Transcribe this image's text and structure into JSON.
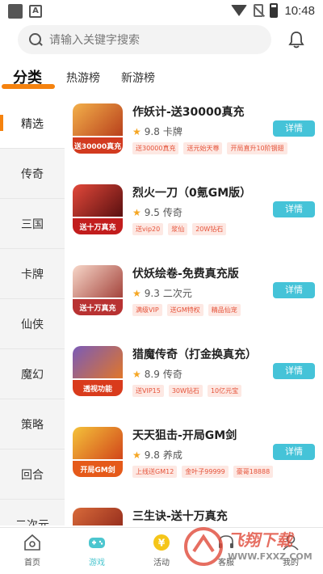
{
  "status_bar": {
    "time": "10:48"
  },
  "search": {
    "placeholder": "请输入关键字搜索"
  },
  "tabs": [
    {
      "label": "分类",
      "active": true
    },
    {
      "label": "热游榜",
      "active": false
    },
    {
      "label": "新游榜",
      "active": false
    }
  ],
  "categories": [
    {
      "label": "精选",
      "active": true
    },
    {
      "label": "传奇"
    },
    {
      "label": "三国"
    },
    {
      "label": "卡牌"
    },
    {
      "label": "仙侠"
    },
    {
      "label": "魔幻"
    },
    {
      "label": "策略"
    },
    {
      "label": "回合"
    },
    {
      "label": "二次元"
    }
  ],
  "games": [
    {
      "title": "作妖计-送30000真充",
      "rating": "9.8",
      "genre": "卡牌",
      "tags": [
        "送30000真充",
        "送元始天尊",
        "开局直升10阶钢翅"
      ],
      "button": "详情",
      "thumb_text": "送30000真充",
      "thumb_color": "#d23a1f"
    },
    {
      "title": "烈火一刀（0氪GM版）",
      "rating": "9.5",
      "genre": "传奇",
      "tags": [
        "送vip20",
        "浆仙",
        "20W钻石"
      ],
      "button": "详情",
      "thumb_text": "送十万真充",
      "thumb_color": "#c21d1d"
    },
    {
      "title": "伏妖绘卷-免费真充版",
      "rating": "9.3",
      "genre": "二次元",
      "tags": [
        "满级VIP",
        "送GM特权",
        "精品仙宠"
      ],
      "button": "详情",
      "thumb_text": "送十万真充",
      "thumb_color": "#b83232"
    },
    {
      "title": "猎魔传奇（打金换真充）",
      "rating": "8.9",
      "genre": "传奇",
      "tags": [
        "送VIP15",
        "30W钻石",
        "10亿元宝"
      ],
      "button": "详情",
      "thumb_text": "透视功能",
      "thumb_color": "#d93b1c"
    },
    {
      "title": "天天狙击-开局GM剑",
      "rating": "9.8",
      "genre": "养成",
      "tags": [
        "上线送GM12",
        "金叶子99999",
        "豪哥18888"
      ],
      "button": "详情",
      "thumb_text": "开局GM剑",
      "thumb_color": "#e55a1a"
    },
    {
      "title": "三生诀-送十万真充",
      "rating": "",
      "genre": "",
      "tags": [],
      "button": "",
      "thumb_text": "",
      "thumb_color": "#c8331f"
    }
  ],
  "bottom_nav": [
    {
      "label": "首页",
      "icon": "home-icon"
    },
    {
      "label": "游戏",
      "icon": "gamepad-icon",
      "active": true
    },
    {
      "label": "活动",
      "icon": "coin-icon"
    },
    {
      "label": "客服",
      "icon": "service-icon"
    },
    {
      "label": "我的",
      "icon": "user-icon"
    }
  ],
  "watermark": {
    "text": "飞翔下载",
    "url": "WWW.FXXZ.COM"
  },
  "colors": {
    "accent": "#f5820e",
    "button": "#45c3d8",
    "tag_text": "#e5533a",
    "tag_bg": "#fde8e3",
    "nav_active": "#4cc6cf"
  }
}
